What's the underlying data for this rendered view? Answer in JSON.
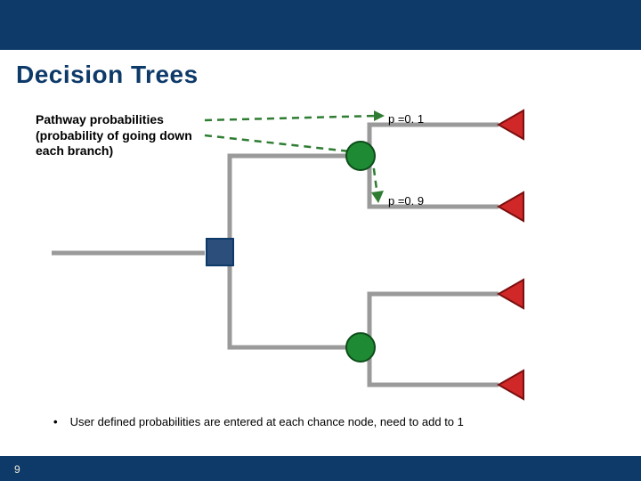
{
  "title": "Decision Trees",
  "callout": {
    "line1": "Pathway probabilities",
    "line2": "(probability of going down",
    "line3": "each branch)"
  },
  "labels": {
    "p_top": "p =0. 1",
    "p_bottom": "p =0. 9"
  },
  "bullet": {
    "text": "User defined probabilities are entered at each chance node, need to add to 1"
  },
  "page_number": "9",
  "chart_data": {
    "type": "diagram",
    "description": "Decision tree: one decision node (square) with two branches; each branch leads to a chance node (green circle); each chance node has two outcomes (red triangles). The upper chance node's two branches are labeled with probabilities 0.1 and 0.9.",
    "decision_node": {
      "type": "decision",
      "shape": "square"
    },
    "branches": [
      {
        "to": {
          "type": "chance",
          "shape": "circle"
        },
        "outcomes": [
          {
            "label": "p =0. 1",
            "value": 0.1,
            "terminal": "triangle"
          },
          {
            "label": "p =0. 9",
            "value": 0.9,
            "terminal": "triangle"
          }
        ]
      },
      {
        "to": {
          "type": "chance",
          "shape": "circle"
        },
        "outcomes": [
          {
            "label": "",
            "value": null,
            "terminal": "triangle"
          },
          {
            "label": "",
            "value": null,
            "terminal": "triangle"
          }
        ]
      }
    ],
    "callout_arrows_target": [
      "branch 1 outcome 1 probability label",
      "branch 1 outcome 2 probability label"
    ]
  }
}
